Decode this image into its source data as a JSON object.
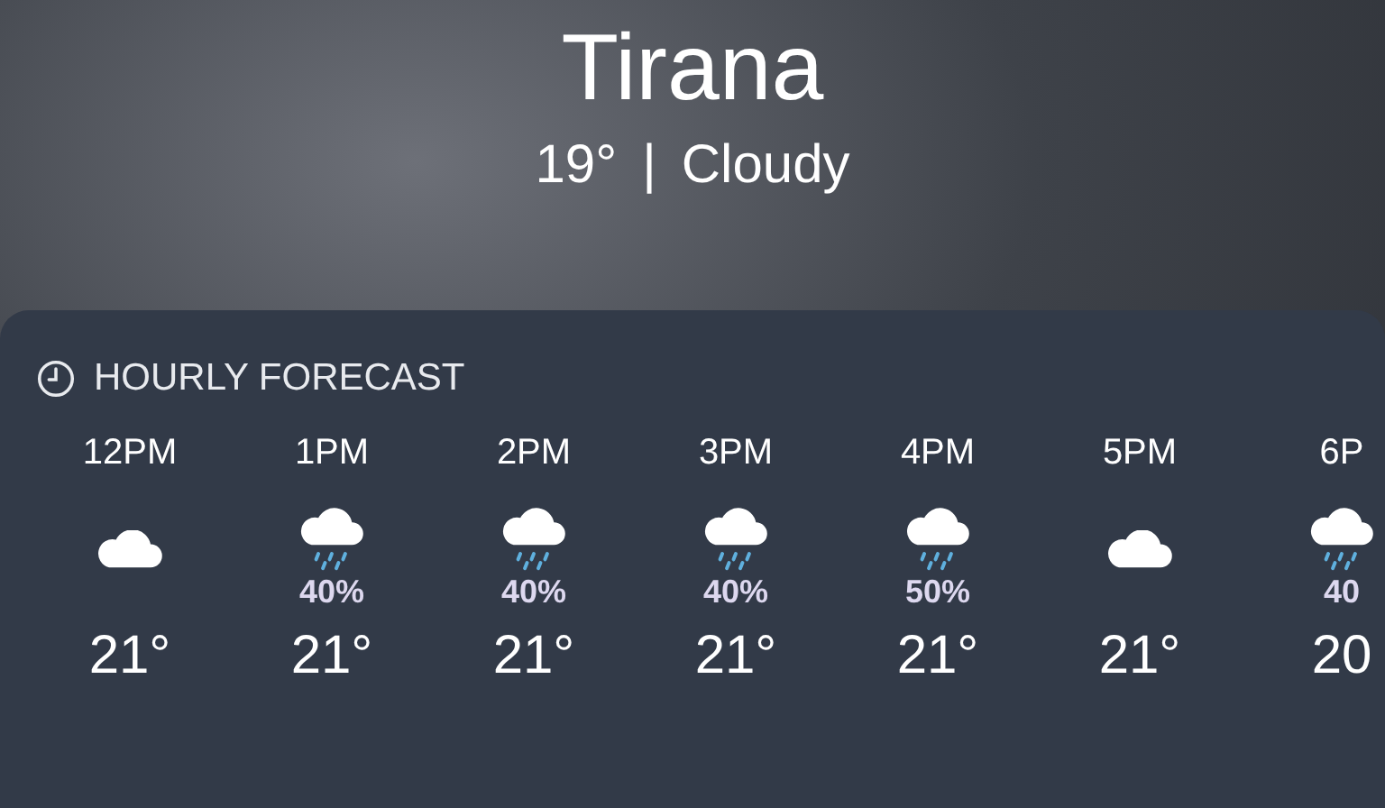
{
  "location": {
    "city": "Tirana",
    "temperature": "19°",
    "divider": "|",
    "condition": "Cloudy"
  },
  "hourly_forecast": {
    "title": "HOURLY FORECAST",
    "hours": [
      {
        "time": "12PM",
        "kind": "cloud",
        "temperature": "21°"
      },
      {
        "time": "1PM",
        "kind": "rain",
        "precipitation": "40%",
        "temperature": "21°"
      },
      {
        "time": "2PM",
        "kind": "rain",
        "precipitation": "40%",
        "temperature": "21°"
      },
      {
        "time": "3PM",
        "kind": "rain",
        "precipitation": "40%",
        "temperature": "21°"
      },
      {
        "time": "4PM",
        "kind": "rain",
        "precipitation": "50%",
        "temperature": "21°"
      },
      {
        "time": "5PM",
        "kind": "cloud",
        "temperature": "21°"
      },
      {
        "time": "6P",
        "kind": "rain",
        "precipitation": "40",
        "temperature": "20"
      }
    ]
  }
}
